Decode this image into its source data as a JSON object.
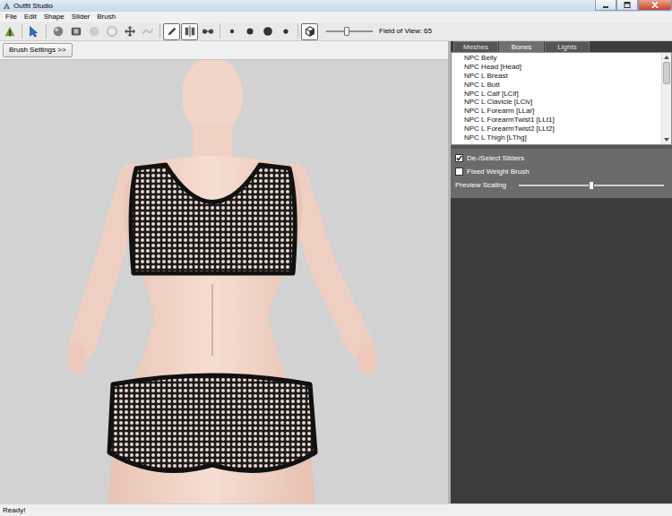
{
  "window": {
    "title": "Outfit Studio"
  },
  "menu": [
    "File",
    "Edit",
    "Shape",
    "Slider",
    "Brush"
  ],
  "toolbar": {
    "tools": [
      {
        "selected": false,
        "disabled": false
      },
      {
        "selected": false,
        "disabled": false
      },
      {
        "selected": false,
        "disabled": false
      },
      {
        "selected": false,
        "disabled": false
      },
      {
        "selected": false,
        "disabled": true
      },
      {
        "selected": false,
        "disabled": true
      },
      {
        "selected": false,
        "disabled": false
      },
      {
        "selected": false,
        "disabled": true
      },
      {
        "selected": true,
        "disabled": false
      },
      {
        "selected": true,
        "disabled": false
      },
      {
        "selected": false,
        "disabled": false
      },
      {
        "selected": false,
        "disabled": false
      },
      {
        "selected": false,
        "disabled": false
      },
      {
        "selected": false,
        "disabled": false
      },
      {
        "selected": false,
        "disabled": false
      },
      {
        "selected": true,
        "disabled": false
      }
    ],
    "fov": {
      "level": 0.45
    },
    "fov_label": "Field of View: 65"
  },
  "brush_settings": "Brush Settings >>",
  "tabs": [
    {
      "label": "Meshes",
      "selected": false
    },
    {
      "label": "Bones",
      "selected": true
    },
    {
      "label": "Lights",
      "selected": false
    }
  ],
  "bones": [
    "NPC Belly",
    "NPC Head [Head]",
    "NPC L Breast",
    "NPC L Butt",
    "NPC L Calf [LClf]",
    "NPC L Clavicle [LClv]",
    "NPC L Forearm [LLar]",
    "NPC L ForearmTwist1 [LLt1]",
    "NPC L ForearmTwist2 [LLt2]",
    "NPC L Thigh [LThg]"
  ],
  "bones_scrollbar": {
    "level": 0.3
  },
  "options": [
    {
      "kind": "checkbox",
      "label": "De-/Select Sliders",
      "checked": true
    },
    {
      "kind": "checkbox",
      "label": "Fixed Weight Brush",
      "checked": false
    },
    {
      "kind": "slider",
      "label": "Preview Scaling",
      "level": 0.5
    }
  ],
  "status_bar": "Ready!"
}
